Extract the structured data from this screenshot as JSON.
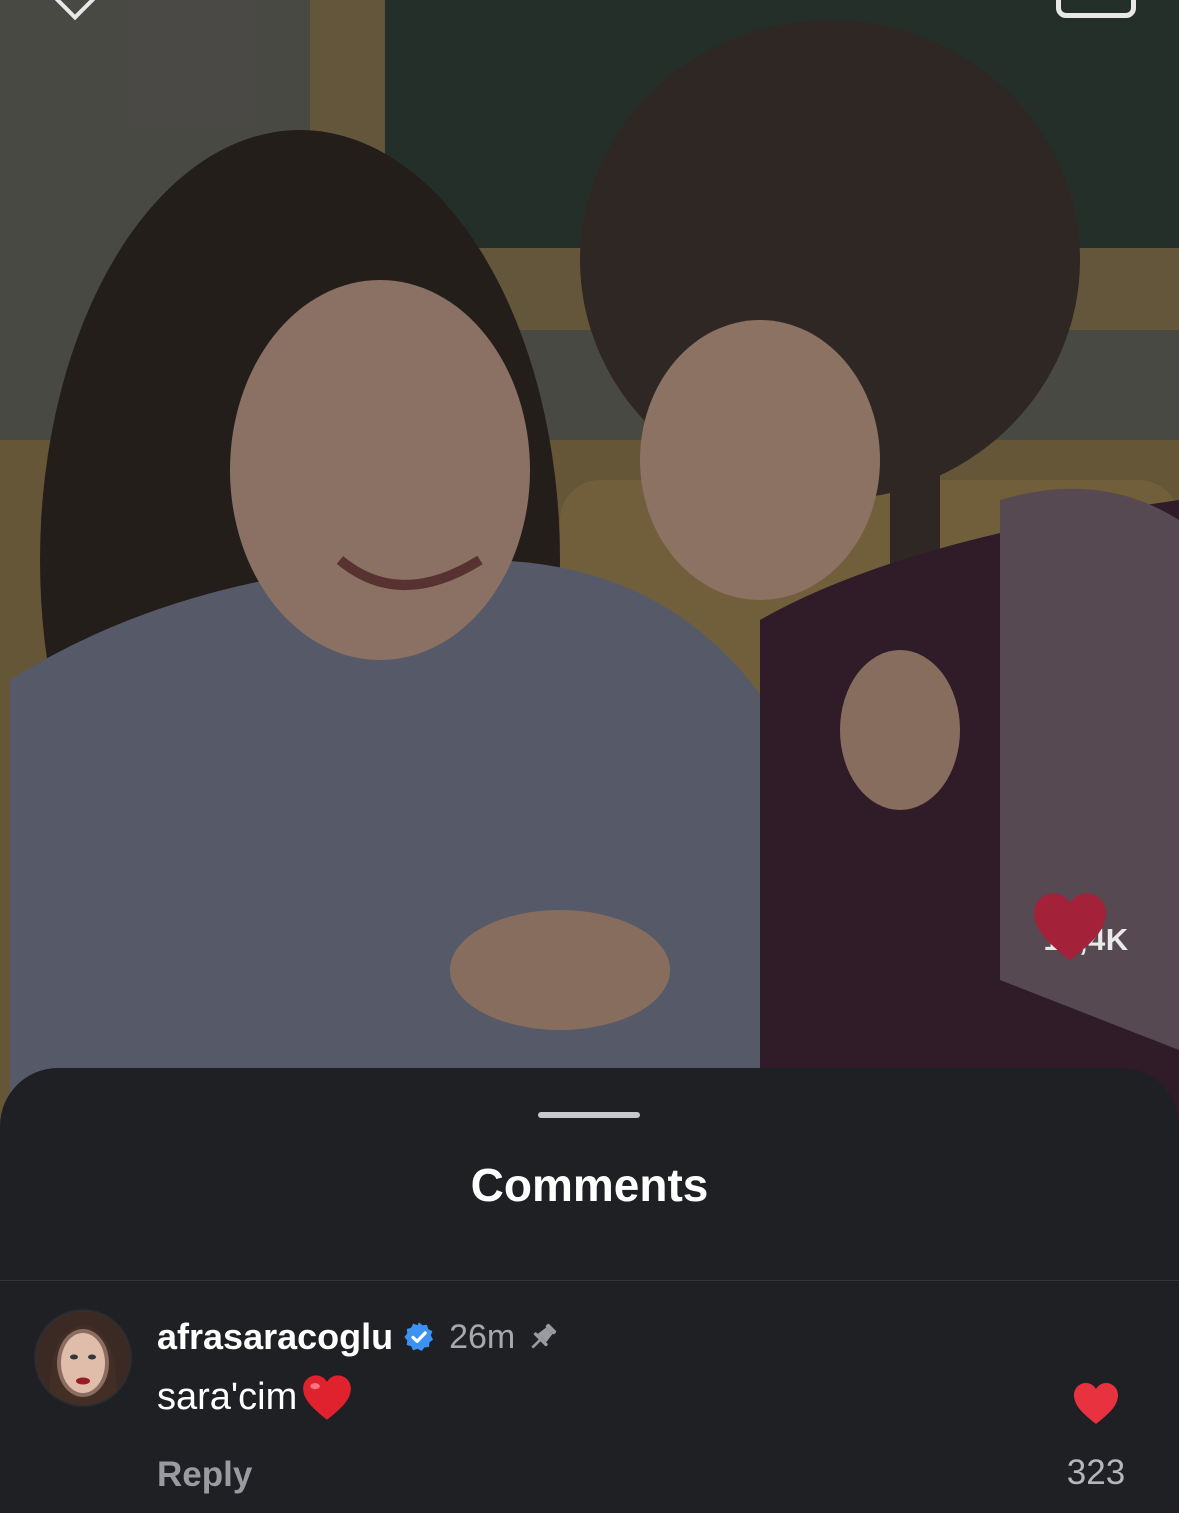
{
  "post": {
    "like_count": "17,4K",
    "like_icon": "heart-icon",
    "like_color": "#a32139"
  },
  "sheet": {
    "title": "Comments"
  },
  "comment": {
    "username": "afrasaracoglu",
    "verified_icon": "verified-badge-icon",
    "timestamp": "26m",
    "pinned_icon": "pin-icon",
    "text": "sara'cim",
    "emoji": "red-heart-emoji",
    "reply_label": "Reply",
    "like_count": "323",
    "like_color": "#e8323f"
  },
  "colors": {
    "sheet_bg": "#1f2024",
    "verified": "#3b92f0",
    "muted_text": "#a7a8ad"
  }
}
